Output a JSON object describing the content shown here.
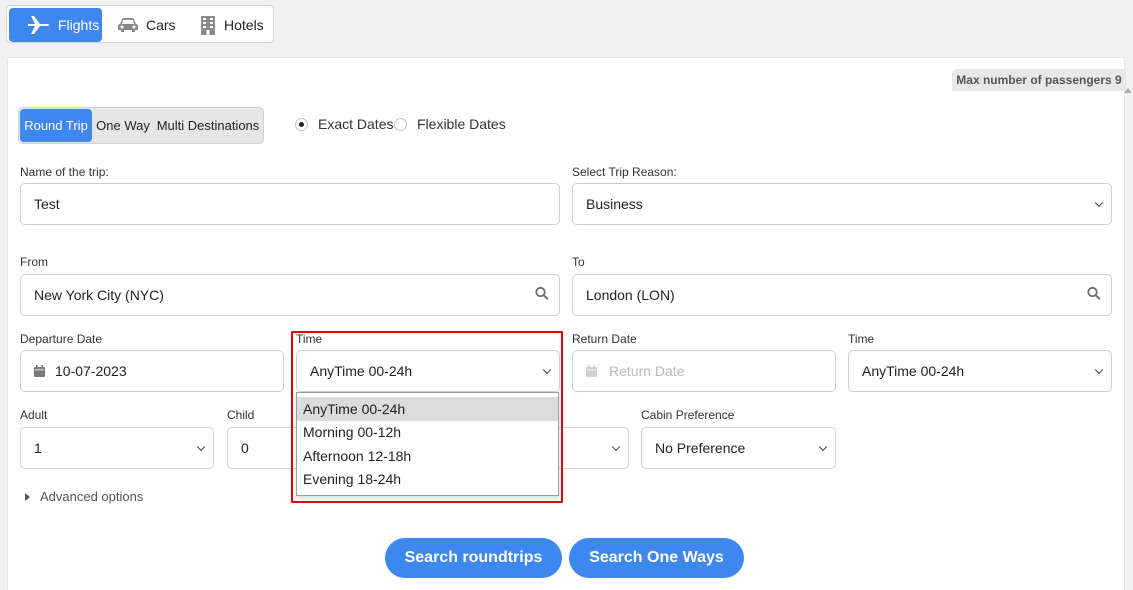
{
  "nav": {
    "tabs": [
      {
        "label": "Flights",
        "icon": "plane-icon"
      },
      {
        "label": "Cars",
        "icon": "car-icon"
      },
      {
        "label": "Hotels",
        "icon": "building-icon"
      }
    ]
  },
  "header": {
    "max_passengers": "Max number of passengers 9"
  },
  "trip_type": {
    "options": [
      "Round Trip",
      "One Way",
      "Multi Destinations"
    ],
    "selected": "Round Trip"
  },
  "date_mode": {
    "options": [
      "Exact Dates",
      "Flexible Dates"
    ],
    "selected": "Exact Dates"
  },
  "form": {
    "trip_name_label": "Name of the trip:",
    "trip_name_value": "Test",
    "trip_reason_label": "Select Trip Reason:",
    "trip_reason_value": "Business",
    "from_label": "From",
    "from_value": "New York City (NYC)",
    "to_label": "To",
    "to_value": "London (LON)",
    "departure_label": "Departure Date",
    "departure_value": "10-07-2023",
    "time_label": "Time",
    "time_value": "AnyTime 00-24h",
    "return_label": "Return Date",
    "return_placeholder": "Return Date",
    "return_time_label": "Time",
    "return_time_value": "AnyTime 00-24h",
    "adult_label": "Adult",
    "adult_value": "1",
    "child_label": "Child",
    "child_value": "0",
    "cabin_label": "Cabin Preference",
    "cabin_value": "No Preference",
    "advanced_label": "Advanced options"
  },
  "time_dropdown": {
    "options": [
      "AnyTime 00-24h",
      "Morning 00-12h",
      "Afternoon 12-18h",
      "Evening 18-24h"
    ],
    "selected": "AnyTime 00-24h"
  },
  "actions": {
    "search_roundtrips": "Search roundtrips",
    "search_oneways": "Search One Ways"
  },
  "colors": {
    "accent": "#3d87ee",
    "highlight": "#e00000"
  }
}
